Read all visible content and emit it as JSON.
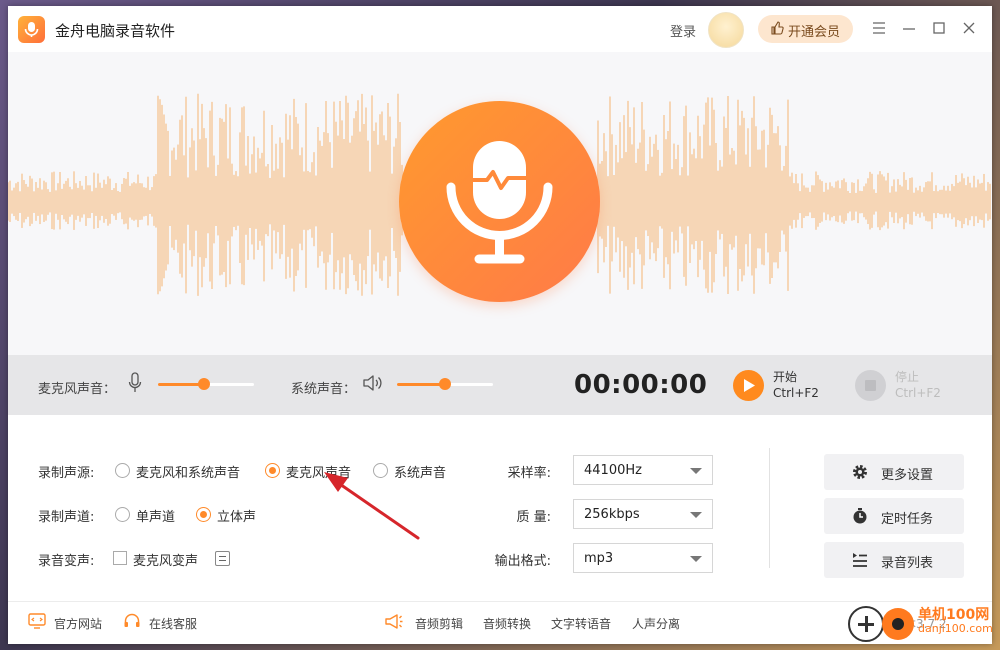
{
  "app": {
    "title": "金舟电脑录音软件",
    "login": "登录",
    "vip_label": "开通会员"
  },
  "controls": {
    "mic_label": "麦克风声音：",
    "mic_volume_pct": 48,
    "system_label": "系统声音：",
    "system_volume_pct": 50,
    "timer": "00:00:00",
    "start_label": "开始",
    "start_shortcut": "Ctrl+F2",
    "stop_label": "停止",
    "stop_shortcut": "Ctrl+F2"
  },
  "settings": {
    "source_label": "录制声源:",
    "source_options": [
      "麦克风和系统声音",
      "麦克风声音",
      "系统声音"
    ],
    "source_selected": "麦克风声音",
    "channel_label": "录制声道:",
    "channel_options": [
      "单声道",
      "立体声"
    ],
    "channel_selected": "立体声",
    "voice_change_label": "录音变声:",
    "voice_change_option": "麦克风变声",
    "voice_change_checked": false,
    "sample_rate_label": "采样率:",
    "sample_rate_value": "44100Hz",
    "quality_label": "质 量:",
    "quality_value": "256kbps",
    "format_label": "输出格式:",
    "format_value": "mp3"
  },
  "side_buttons": {
    "more_settings": "更多设置",
    "scheduled_task": "定时任务",
    "record_list": "录音列表"
  },
  "footer": {
    "website": "官方网站",
    "support": "在线客服",
    "audio_edit": "音频剪辑",
    "audio_convert": "音频转换",
    "text_to_speech": "文字转语音",
    "vocal_separation": "人声分离",
    "version_partial": "本3.7.2",
    "watermark_title": "单机100网",
    "watermark_url": "danji100.com"
  },
  "colors": {
    "accent": "#ff8a2a",
    "wave": "#f6c89a",
    "control_bg": "#e6e6e8"
  }
}
